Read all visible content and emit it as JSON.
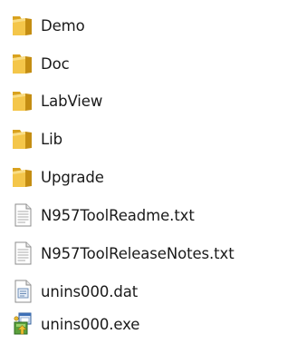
{
  "file_list": {
    "items": [
      {
        "name": "Demo",
        "icon": "folder-icon",
        "type": "folder"
      },
      {
        "name": "Doc",
        "icon": "folder-icon",
        "type": "folder"
      },
      {
        "name": "LabView",
        "icon": "folder-icon",
        "type": "folder"
      },
      {
        "name": "Lib",
        "icon": "folder-icon",
        "type": "folder"
      },
      {
        "name": "Upgrade",
        "icon": "folder-icon",
        "type": "folder"
      },
      {
        "name": "N957ToolReadme.txt",
        "icon": "text-file-icon",
        "type": "text-file"
      },
      {
        "name": "N957ToolReleaseNotes.txt",
        "icon": "text-file-icon",
        "type": "text-file"
      },
      {
        "name": "unins000.dat",
        "icon": "data-file-icon",
        "type": "data-file"
      },
      {
        "name": "unins000.exe",
        "icon": "installer-exe-icon",
        "type": "executable"
      }
    ]
  },
  "colors": {
    "folder_front": "#f4c64a",
    "folder_back": "#d9a21f",
    "text": "#1a1a1a"
  }
}
